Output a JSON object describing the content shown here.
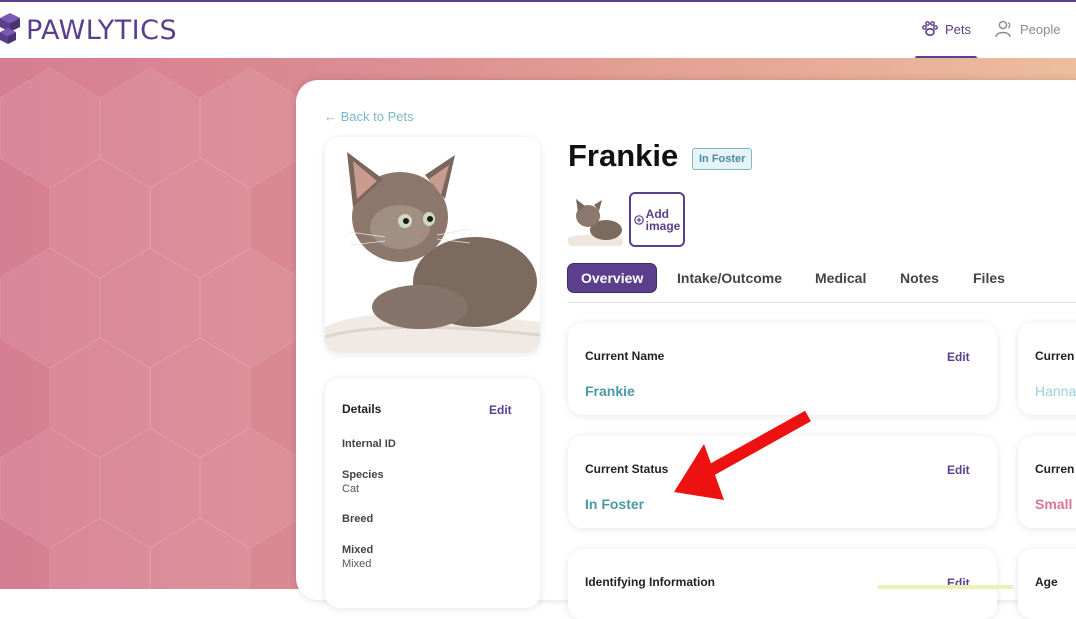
{
  "app": {
    "logo_text": "PAWLYTICS"
  },
  "nav": {
    "pets_label": "Pets",
    "people_label": "People"
  },
  "back_link": "← Back to Pets",
  "pet": {
    "name": "Frankie",
    "status_badge": "In Foster"
  },
  "add_image": {
    "line1": "Add",
    "line2": "image"
  },
  "tabs": [
    {
      "label": "Overview",
      "active": true
    },
    {
      "label": "Intake/Outcome",
      "active": false
    },
    {
      "label": "Medical",
      "active": false
    },
    {
      "label": "Notes",
      "active": false
    },
    {
      "label": "Files",
      "active": false
    }
  ],
  "details": {
    "title": "Details",
    "edit_label": "Edit",
    "fields": [
      {
        "label": "Internal ID",
        "value": ""
      },
      {
        "label": "Species",
        "value": "Cat"
      },
      {
        "label": "Breed",
        "value": ""
      },
      {
        "label": "Mixed",
        "value": "Mixed"
      }
    ]
  },
  "overview_cards": [
    {
      "label": "Current Name",
      "edit_label": "Edit",
      "value": "Frankie"
    },
    {
      "label": "Current Status",
      "edit_label": "Edit",
      "value": "In Foster"
    },
    {
      "label": "Identifying Information",
      "edit_label": "Edit",
      "value": ""
    }
  ],
  "right_cards": [
    {
      "label": "Curren",
      "value": "Hanna"
    },
    {
      "label": "Curren",
      "value": "Small"
    },
    {
      "label": "Age",
      "value": ""
    }
  ],
  "colors": {
    "brand": "#5b3f8c",
    "teal_value": "#4a9aa5",
    "pink_value": "#d97792",
    "annotation_arrow": "#ee1111"
  }
}
